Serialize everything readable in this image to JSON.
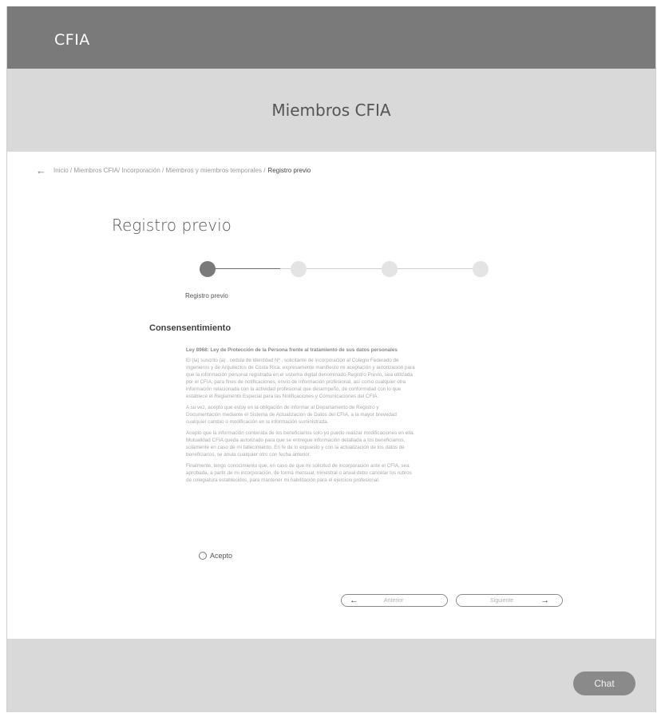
{
  "header": {
    "brand": "CFIA"
  },
  "hero": {
    "title": "Miembros CFIA"
  },
  "breadcrumb": {
    "back_icon": "arrow-left-icon",
    "trail": "Inicio / Miembros CFIA/ Incorporación / Miembros y miembros temporales /",
    "current": "Registro previo"
  },
  "page": {
    "title": "Registro previo"
  },
  "stepper": {
    "steps": 4,
    "active_step": 1,
    "active_label": "Registro previo"
  },
  "consent": {
    "section_title": "Consensentimiento",
    "law_title": "Ley 8968: Ley de Protección de la Persona frente al tratamiento de sus datos personales",
    "paragraphs": [
      "El (la) suscrito (a) , cedula de identidad Nº , solicitante de incorporación al Colegio Federado de Ingenieros y de Arquitectos de Costa Rica, expresamente manifiesto mi aceptación y autorización para que la información personal registrada en el sistema digital denominado Registro Previo, sea utilizada por el CFIA, para fines de notificaciones, envío de información profesional, así como cualquier otra información relacionada con la actividad profesional que desempeño, de conformidad con lo que establece el Reglamento Especial para las Notificaciones y Comunicaciones del CFIA.",
      "A su vez, acepto que estoy en la obligación de informar al Departamento de Registro y Documentación mediante el Sistema de Actualización de Datos del CFIA, a la mayor brevedad cualquier cambio o modificación en la información suministrada.",
      "Acepto que la información contenida de los beneficiarios solo yo puedo realizar modificaciones en ella. Mutualidad CFIA queda autorizado para que se entregue información detallada a los beneficiarios, solamente en caso de mi fallecimiento. En fe de lo expuesto y con la actualización de los datos de beneficiarios, se anula cualquier otro con fecha anterior.",
      "Finalmente, tengo conocimiento que, en caso de que mi solicitud de incorporación ante el CFIA, sea aprobada, a partir de mi incorporación, de forma mensual, trimestral o anual debo cancelar los rubros de colegiatura establecidos, para mantener mi habilitación para el ejercicio profesional."
    ],
    "accept_label": "Acepto"
  },
  "navigation": {
    "prev_label": "Anterior",
    "next_label": "Siguiente",
    "prev_icon": "arrow-left-icon",
    "next_icon": "arrow-right-icon"
  },
  "chat": {
    "label": "Chat"
  },
  "colors": {
    "header_bg": "#7a7a7a",
    "hero_bg": "#d9d9d9",
    "footer_bg": "#d9d9d9",
    "step_active": "#7a7a7a",
    "step_inactive": "#e4e4e4",
    "chat_bg": "#8a8a8a"
  }
}
